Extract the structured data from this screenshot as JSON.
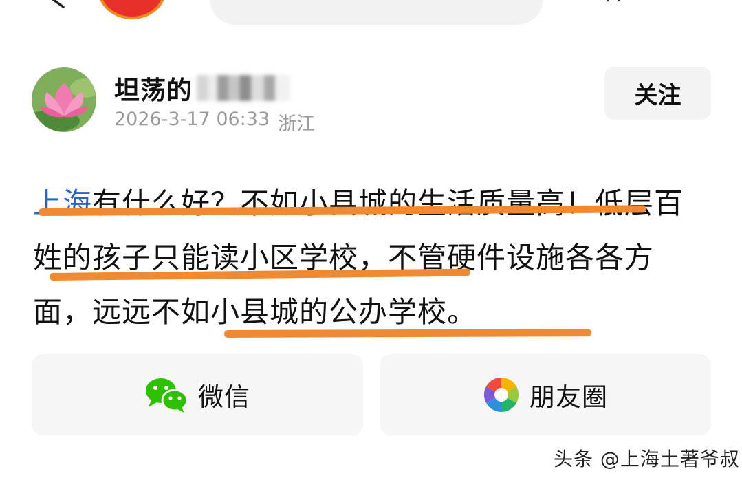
{
  "header": {
    "icons": [
      "chevron-left-icon",
      "app-avatar-icon",
      "share-more-icon"
    ]
  },
  "post": {
    "author": "坦荡的",
    "date": "2026-3-17 06:33",
    "location": "浙江",
    "follow_label": "关注",
    "text_link": "上海",
    "text_body": "有什么好？不如小县城的生活质量高！低层百姓的孩子只能读小区学校，不管硬件设施各各方面，远远不如小县城的公办学校。",
    "link_color": "#2a64c8",
    "highlight_color": "#f08a32"
  },
  "share": {
    "wechat_label": "微信",
    "moments_label": "朋友圈"
  },
  "watermark": "头条 @上海土著爷叔"
}
